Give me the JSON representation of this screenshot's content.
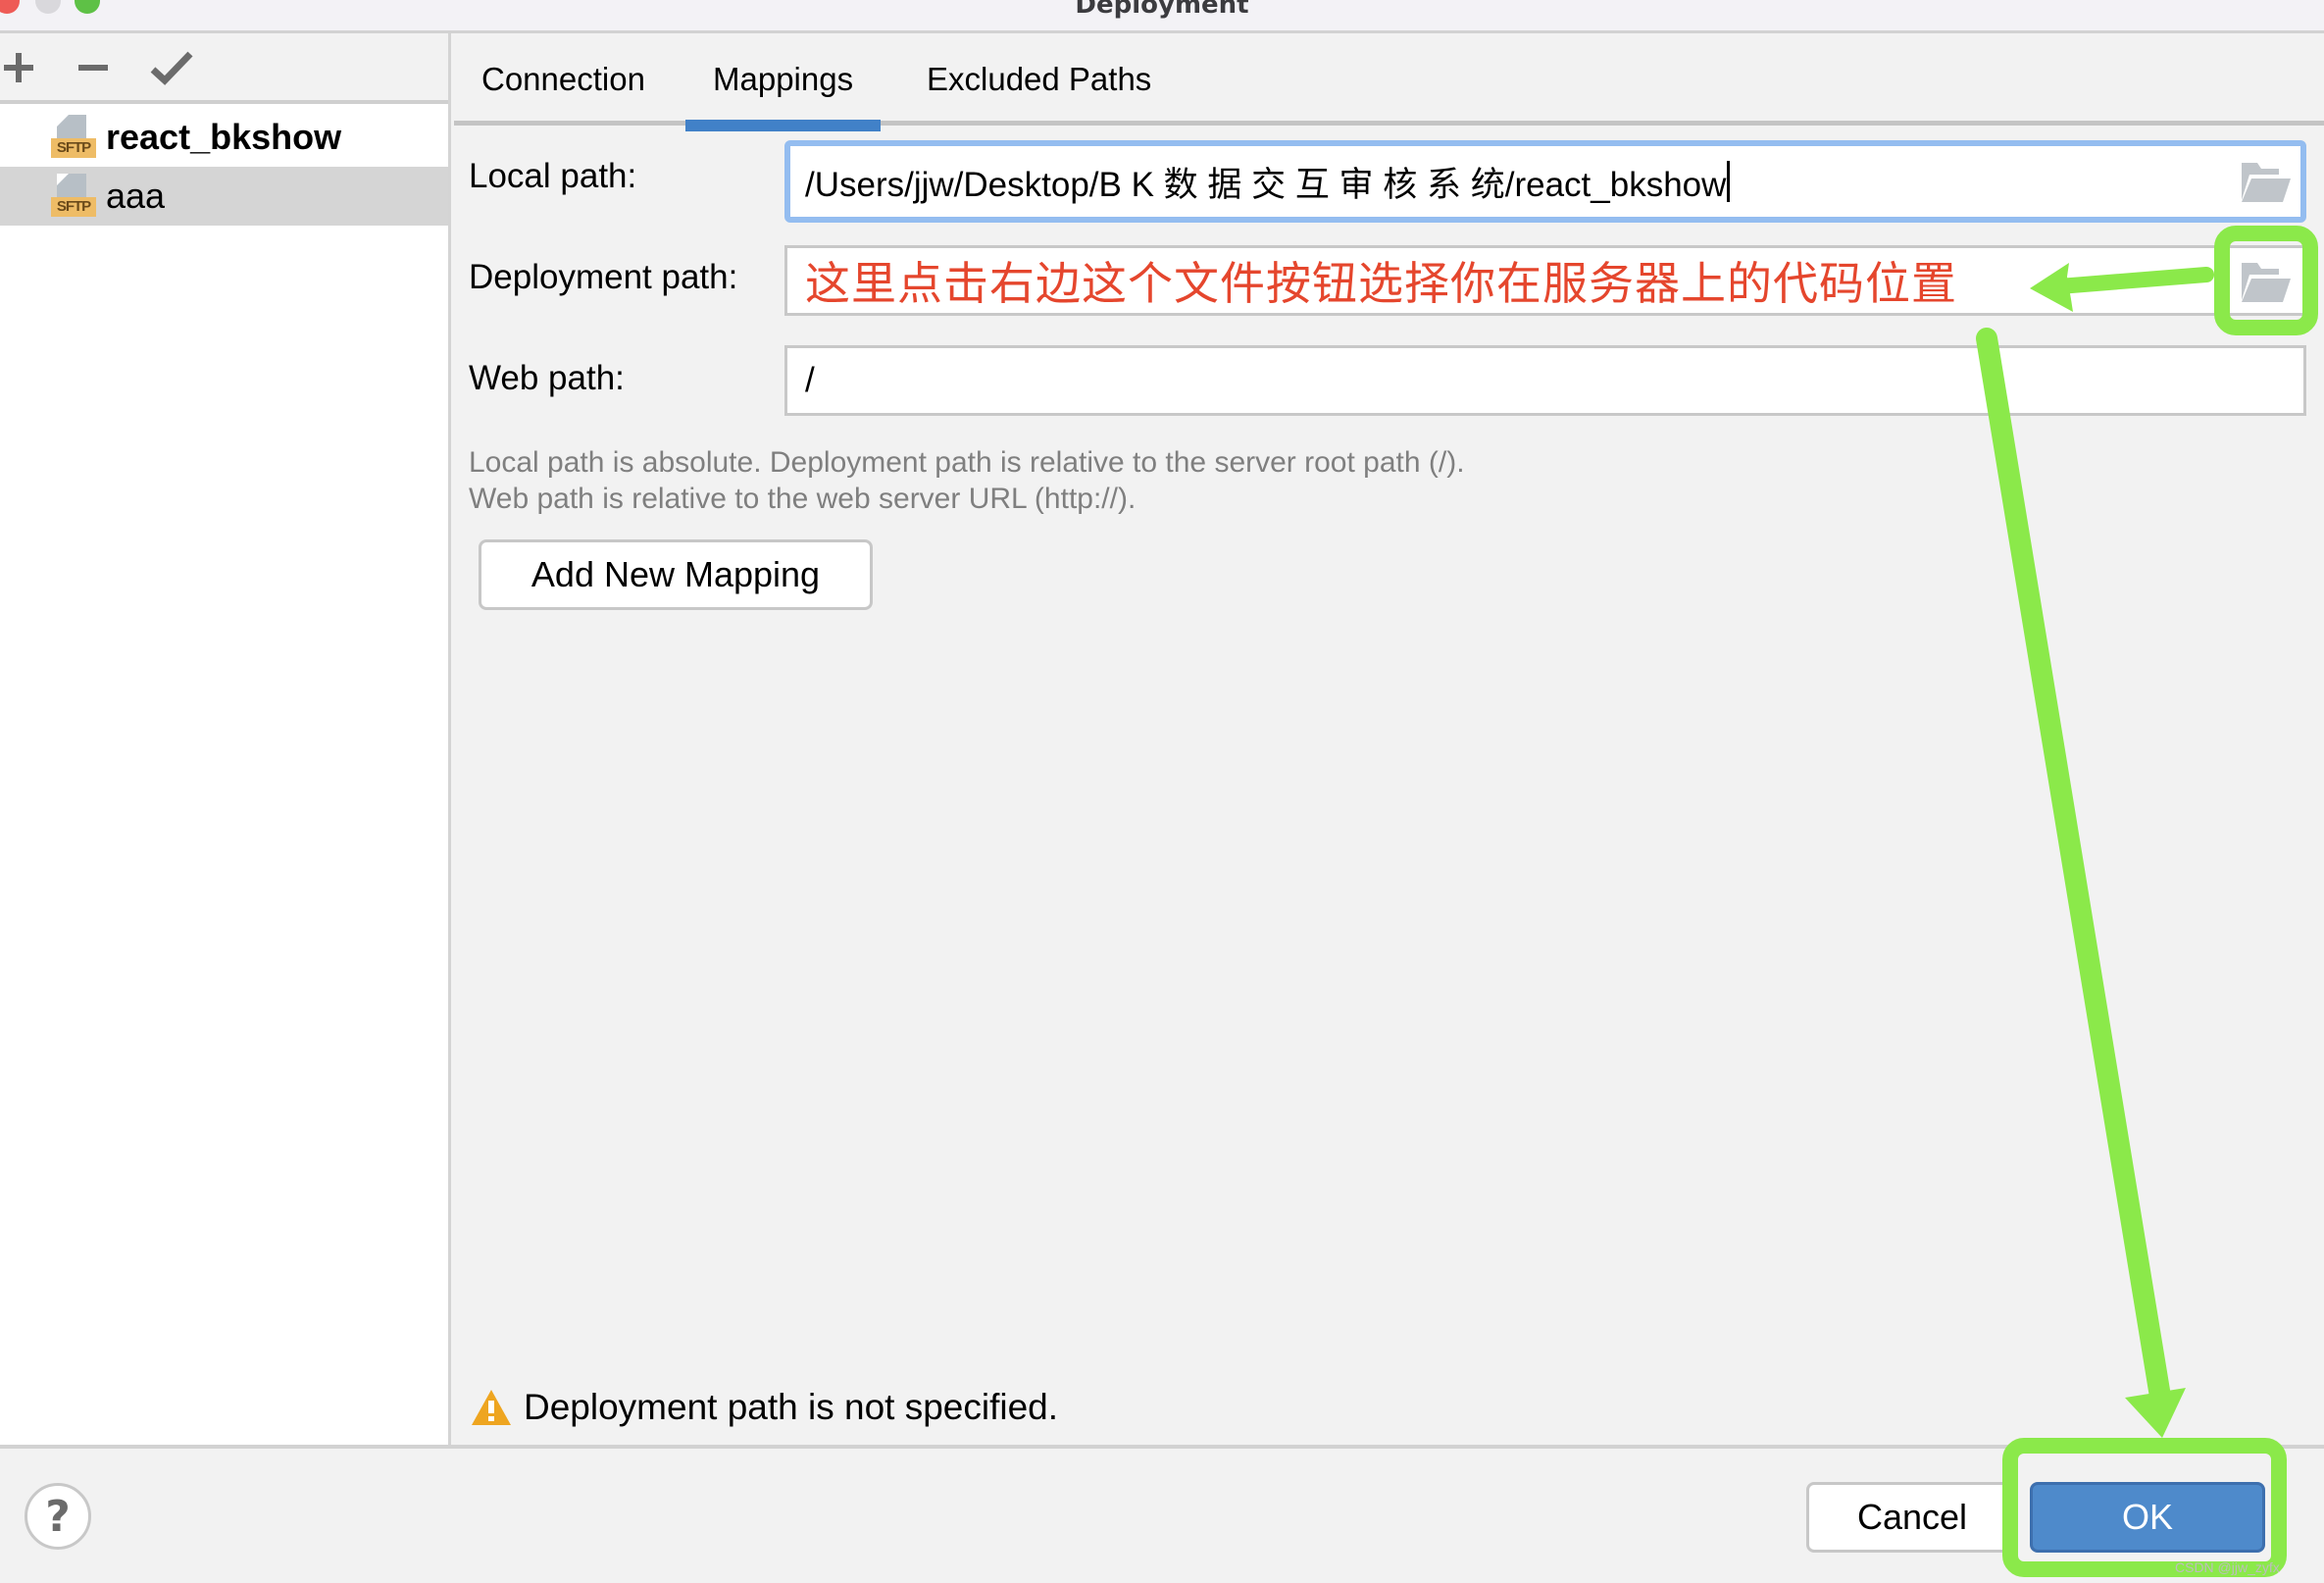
{
  "window": {
    "title": "Deployment"
  },
  "sidebar": {
    "toolbar": {
      "add_icon": "plus-icon",
      "remove_icon": "minus-icon",
      "default_icon": "check-icon"
    },
    "servers": [
      {
        "name": "react_bkshow",
        "type_badge": "SFTP",
        "bold": true,
        "selected": false
      },
      {
        "name": "aaa",
        "type_badge": "SFTP",
        "bold": false,
        "selected": true
      }
    ]
  },
  "tabs": [
    {
      "label": "Connection",
      "active": false
    },
    {
      "label": "Mappings",
      "active": true
    },
    {
      "label": "Excluded Paths",
      "active": false
    }
  ],
  "form": {
    "local_path": {
      "label": "Local path:",
      "value": "/Users/jjw/Desktop/B K 数 据 交 互 审 核 系 统/react_bkshow",
      "icon": "folder-icon"
    },
    "deployment_path": {
      "label": "Deployment path:",
      "value": "",
      "icon": "folder-icon"
    },
    "web_path": {
      "label": "Web path:",
      "value": "/"
    },
    "help_lines": [
      "Local path is absolute. Deployment path is relative to the server root path (/).",
      "Web path is relative to the web server URL (http://)."
    ],
    "add_mapping_label": "Add New Mapping"
  },
  "warning": {
    "icon": "warning-icon",
    "text": "Deployment path is not specified."
  },
  "footer": {
    "help_label": "?",
    "cancel_label": "Cancel",
    "ok_label": "OK"
  },
  "annotation": {
    "text": "这里点击右边这个文件按钮选择你在服务器上的代码位置",
    "text_color": "#e5462d",
    "highlight_color": "#8be94a"
  },
  "colors": {
    "accent": "#4181c8",
    "primary_button": "#4e8acb",
    "focus_border": "#94bdf0",
    "warning": "#eea520"
  },
  "watermark": "CSDN @jjw_zyfx"
}
